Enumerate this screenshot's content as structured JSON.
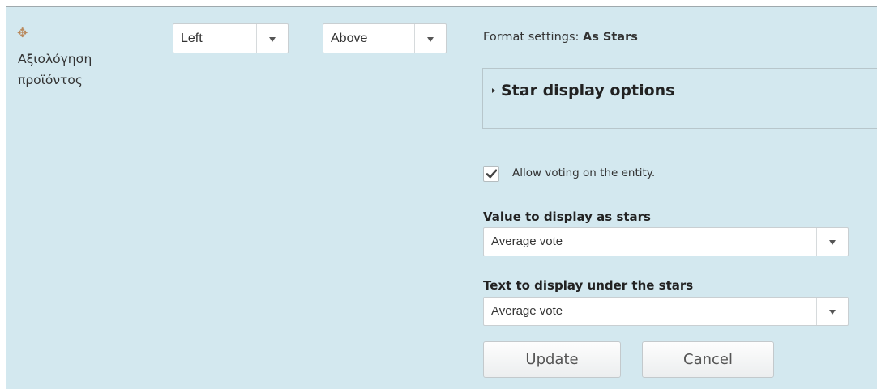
{
  "field": {
    "label": "Αξιολόγηση προϊόντος",
    "drag_icon_glyph": "✥"
  },
  "label_position": {
    "selected": "Left"
  },
  "label_display": {
    "selected": "Above"
  },
  "format": {
    "prefix": "Format settings:",
    "name": "As Stars"
  },
  "star_display": {
    "legend": "Star display options"
  },
  "voting": {
    "checked": true,
    "label": "Allow voting on the entity."
  },
  "value_display": {
    "label": "Value to display as stars",
    "selected": "Average vote"
  },
  "text_display": {
    "label": "Text to display under the stars",
    "selected": "Average vote"
  },
  "buttons": {
    "update": "Update",
    "cancel": "Cancel"
  },
  "colors": {
    "panel_bg": "#d3e8ef",
    "drag_icon": "#b98a5e"
  }
}
